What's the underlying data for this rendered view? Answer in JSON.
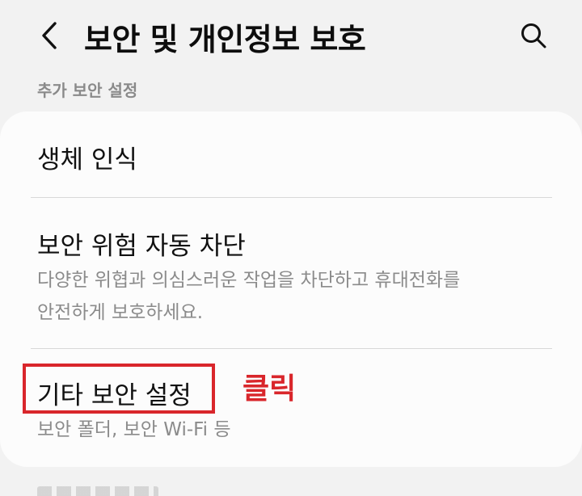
{
  "header": {
    "title": "보안 및 개인정보 보호",
    "back_icon": "chevron-left-icon",
    "search_icon": "search-icon"
  },
  "section": {
    "label": "추가 보안 설정"
  },
  "items": [
    {
      "title": "생체 인식"
    },
    {
      "title": "보안 위험 자동 차단",
      "summary_line1": "다양한 위협과 의심스러운 작업을 차단하고 휴대전화를",
      "summary_line2": "안전하게 보호하세요."
    },
    {
      "title": "기타 보안 설정",
      "summary": "보안 폴더, 보안 Wi-Fi 등"
    }
  ],
  "annotation": {
    "label": "클릭",
    "color": "#d9262b"
  },
  "colors": {
    "background": "#f2f2f2",
    "card": "#fcfcfc",
    "summary_text": "#8b8b8b"
  }
}
